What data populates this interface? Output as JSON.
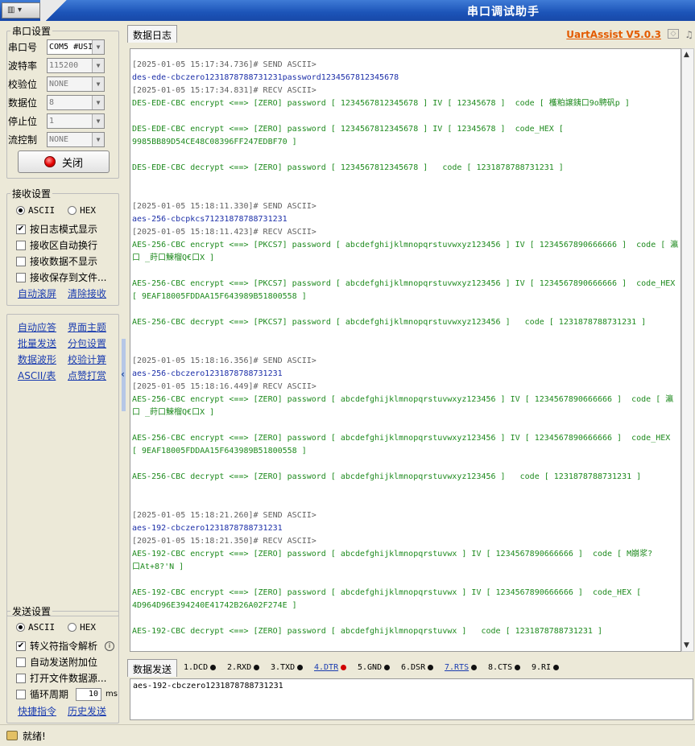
{
  "titlebar": {
    "sysmenu": "▾",
    "title": "串口调试助手"
  },
  "serial_settings": {
    "legend": "串口设置",
    "rows": [
      {
        "label": "串口号",
        "value": "COM5 #USI"
      },
      {
        "label": "波特率",
        "value": "115200"
      },
      {
        "label": "校验位",
        "value": "NONE"
      },
      {
        "label": "数据位",
        "value": "8"
      },
      {
        "label": "停止位",
        "value": "1"
      },
      {
        "label": "流控制",
        "value": "NONE"
      }
    ],
    "close_button": "关闭"
  },
  "receive_settings": {
    "legend": "接收设置",
    "radio": [
      "ASCII",
      "HEX"
    ],
    "checks": [
      {
        "label": "按日志模式显示",
        "checked": true
      },
      {
        "label": "接收区自动换行",
        "checked": false
      },
      {
        "label": "接收数据不显示",
        "checked": false
      },
      {
        "label": "接收保存到文件...",
        "checked": false
      }
    ],
    "links": [
      "自动滚屏",
      "清除接收"
    ]
  },
  "tools": [
    [
      "自动应答",
      "界面主题"
    ],
    [
      "批量发送",
      "分包设置"
    ],
    [
      "数据波形",
      "校验计算"
    ],
    [
      "ASCII/表",
      "点赞打赏"
    ]
  ],
  "send_settings": {
    "legend": "发送设置",
    "radio": [
      "ASCII",
      "HEX"
    ],
    "checks": [
      {
        "label": "转义符指令解析",
        "checked": true
      },
      {
        "label": "自动发送附加位",
        "checked": false
      },
      {
        "label": "打开文件数据源...",
        "checked": false
      },
      {
        "label": "循环周期",
        "checked": false
      }
    ],
    "period_value": "10",
    "period_unit": "ms",
    "links": [
      "快捷指令",
      "历史发送"
    ]
  },
  "receive_tab": "数据日志",
  "brand": "UartAssist V5.0.3",
  "log_lines": [
    {
      "t": "[2025-01-05 15:17:34.736]# SEND ASCII>",
      "c": "head"
    },
    {
      "t": "des-ede-cbczero1231878788731231password1234567812345678",
      "c": "send"
    },
    {
      "t": "[2025-01-05 15:17:34.831]# RECV ASCII>",
      "c": "head"
    },
    {
      "t": "DES-EDE-CBC encrypt <==> [ZERO] password [ 1234567812345678 ] IV [ 12345678 ]  code [ 檴粕譲銕口9o騁矾p ]",
      "c": "recv"
    },
    {
      "t": "",
      "c": "recv"
    },
    {
      "t": "DES-EDE-CBC encrypt <==> [ZERO] password [ 1234567812345678 ] IV [ 12345678 ]  code_HEX [",
      "c": "recv"
    },
    {
      "t": "9985BB89D54CE48C08396FF247EDBF70 ]",
      "c": "recv"
    },
    {
      "t": "",
      "c": "recv"
    },
    {
      "t": "DES-EDE-CBC decrypt <==> [ZERO] password [ 1234567812345678 ]   code [ 1231878788731231 ]",
      "c": "recv"
    },
    {
      "t": "",
      "c": "recv"
    },
    {
      "t": "",
      "c": "recv"
    },
    {
      "t": "[2025-01-05 15:18:11.330]# SEND ASCII>",
      "c": "head"
    },
    {
      "t": "aes-256-cbcpkcs71231878788731231",
      "c": "send"
    },
    {
      "t": "[2025-01-05 15:18:11.423]# RECV ASCII>",
      "c": "head"
    },
    {
      "t": "AES-256-CBC encrypt <==> [PKCS7] password [ abcdefghijklmnopqrstuvwxyz123456 ] IV [ 1234567890666666 ]  code [ 瀛",
      "c": "recv"
    },
    {
      "t": "口 _莳口鰊榴Q€口X ]",
      "c": "recv"
    },
    {
      "t": "",
      "c": "recv"
    },
    {
      "t": "AES-256-CBC encrypt <==> [PKCS7] password [ abcdefghijklmnopqrstuvwxyz123456 ] IV [ 1234567890666666 ]  code_HEX",
      "c": "recv"
    },
    {
      "t": "[ 9EAF18005FDDAA15F643989B51800558 ]",
      "c": "recv"
    },
    {
      "t": "",
      "c": "recv"
    },
    {
      "t": "AES-256-CBC decrypt <==> [PKCS7] password [ abcdefghijklmnopqrstuvwxyz123456 ]   code [ 1231878788731231 ]",
      "c": "recv"
    },
    {
      "t": "",
      "c": "recv"
    },
    {
      "t": "",
      "c": "recv"
    },
    {
      "t": "[2025-01-05 15:18:16.356]# SEND ASCII>",
      "c": "head"
    },
    {
      "t": "aes-256-cbczero1231878788731231",
      "c": "send"
    },
    {
      "t": "[2025-01-05 15:18:16.449]# RECV ASCII>",
      "c": "head"
    },
    {
      "t": "AES-256-CBC encrypt <==> [ZERO] password [ abcdefghijklmnopqrstuvwxyz123456 ] IV [ 1234567890666666 ]  code [ 瀛",
      "c": "recv"
    },
    {
      "t": "口 _莳口鰊榴Q€口X ]",
      "c": "recv"
    },
    {
      "t": "",
      "c": "recv"
    },
    {
      "t": "AES-256-CBC encrypt <==> [ZERO] password [ abcdefghijklmnopqrstuvwxyz123456 ] IV [ 1234567890666666 ]  code_HEX",
      "c": "recv"
    },
    {
      "t": "[ 9EAF18005FDDAA15F643989B51800558 ]",
      "c": "recv"
    },
    {
      "t": "",
      "c": "recv"
    },
    {
      "t": "AES-256-CBC decrypt <==> [ZERO] password [ abcdefghijklmnopqrstuvwxyz123456 ]   code [ 1231878788731231 ]",
      "c": "recv"
    },
    {
      "t": "",
      "c": "recv"
    },
    {
      "t": "",
      "c": "recv"
    },
    {
      "t": "[2025-01-05 15:18:21.260]# SEND ASCII>",
      "c": "head"
    },
    {
      "t": "aes-192-cbczero1231878788731231",
      "c": "send"
    },
    {
      "t": "[2025-01-05 15:18:21.350]# RECV ASCII>",
      "c": "head"
    },
    {
      "t": "AES-192-CBC encrypt <==> [ZERO] password [ abcdefghijklmnopqrstuvwx ] IV [ 1234567890666666 ]  code [ M崩浆?",
      "c": "recv"
    },
    {
      "t": "口At+8?'N ]",
      "c": "recv"
    },
    {
      "t": "",
      "c": "recv"
    },
    {
      "t": "AES-192-CBC encrypt <==> [ZERO] password [ abcdefghijklmnopqrstuvwx ] IV [ 1234567890666666 ]  code_HEX [",
      "c": "recv"
    },
    {
      "t": "4D964D96E394240E41742B26A02F274E ]",
      "c": "recv"
    },
    {
      "t": "",
      "c": "recv"
    },
    {
      "t": "AES-192-CBC decrypt <==> [ZERO] password [ abcdefghijklmnopqrstuvwx ]   code [ 1231878788731231 ]",
      "c": "recv"
    }
  ],
  "send_tab": "数据发送",
  "pins": [
    {
      "label": "1.DCD",
      "link": false,
      "red": false
    },
    {
      "label": "2.RXD",
      "link": false,
      "red": false
    },
    {
      "label": "3.TXD",
      "link": false,
      "red": false
    },
    {
      "label": "4.DTR",
      "link": true,
      "red": true
    },
    {
      "label": "5.GND",
      "link": false,
      "red": false
    },
    {
      "label": "6.DSR",
      "link": false,
      "red": false
    },
    {
      "label": "7.RTS",
      "link": true,
      "red": false
    },
    {
      "label": "8.CTS",
      "link": false,
      "red": false
    },
    {
      "label": "9.RI",
      "link": false,
      "red": false
    }
  ],
  "send_text": "aes-192-cbczero1231878788731231",
  "status_text": "就绪!",
  "colors": {
    "head": "#606060",
    "send": "#1c2fa8",
    "recv": "#1e8a1e",
    "brand": "#e35b00"
  }
}
